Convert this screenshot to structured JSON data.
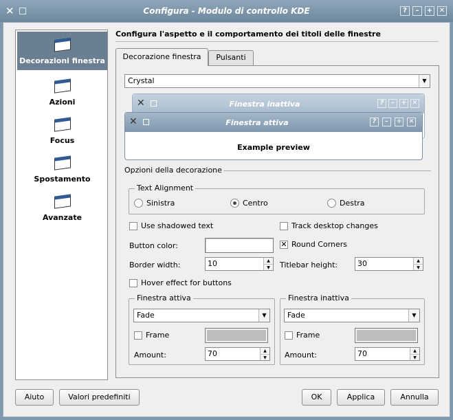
{
  "window": {
    "title": "Configura - Modulo di controllo KDE",
    "buttons": [
      "?",
      "–",
      "+",
      "✕"
    ]
  },
  "header": "Configura l'aspetto e il comportamento dei titoli delle finestre",
  "nav": [
    {
      "label": "Decorazioni finestra"
    },
    {
      "label": "Azioni"
    },
    {
      "label": "Focus"
    },
    {
      "label": "Spostamento"
    },
    {
      "label": "Avanzate"
    }
  ],
  "tabs": [
    {
      "label": "Decorazione finestra"
    },
    {
      "label": "Pulsanti"
    }
  ],
  "theme": "Crystal",
  "preview": {
    "inactive": "Finestra inattiva",
    "active": "Finestra attiva",
    "text": "Example preview"
  },
  "options": {
    "section": "Opzioni della decorazione",
    "alignment": {
      "title": "Text Alignment",
      "choices": [
        "Sinistra",
        "Centro",
        "Destra"
      ],
      "selected": "Centro"
    },
    "shadowed": "Use shadowed text",
    "shadowed_checked": false,
    "track": "Track desktop changes",
    "track_checked": false,
    "button_color": "Button color:",
    "round": "Round Corners",
    "round_checked": true,
    "border_width": "Border width:",
    "border_width_value": "10",
    "titlebar_height": "Titlebar height:",
    "titlebar_height_value": "30",
    "hover": "Hover effect for buttons",
    "hover_checked": false,
    "active": {
      "title": "Finestra attiva",
      "mode": "Fade",
      "frame": "Frame",
      "amount": "Amount:",
      "amount_value": "70"
    },
    "inactive": {
      "title": "Finestra inattiva",
      "mode": "Fade",
      "frame": "Frame",
      "amount": "Amount:",
      "amount_value": "70"
    }
  },
  "footer": {
    "help": "Aiuto",
    "defaults": "Valori predefiniti",
    "ok": "OK",
    "apply": "Applica",
    "cancel": "Annulla"
  }
}
